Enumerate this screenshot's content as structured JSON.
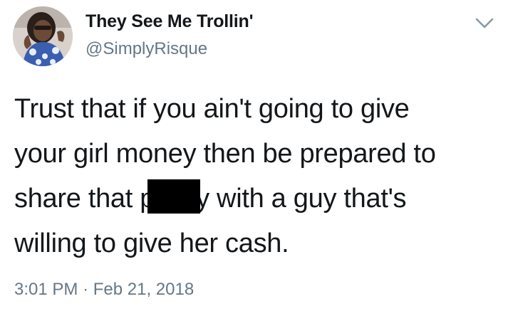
{
  "author": {
    "display_name": "They See Me Trollin'",
    "handle": "@SimplyRisque",
    "avatar_icon": "profile-photo"
  },
  "tweet": {
    "lines": [
      [
        "Trust that if you ain't going to give"
      ],
      [
        "your girl money then be prepared to"
      ],
      [
        "share that p",
        "y with a guy that's"
      ],
      [
        "willing to give her cash."
      ]
    ],
    "censored": true
  },
  "meta": {
    "time": "3:01 PM",
    "separator": "·",
    "date": "Feb 21, 2018"
  },
  "icons": {
    "menu": "chevron-down-icon"
  },
  "colors": {
    "text_primary": "#14171a",
    "text_secondary": "#657786",
    "caret": "#8899a6",
    "censor_box": "#000000"
  }
}
